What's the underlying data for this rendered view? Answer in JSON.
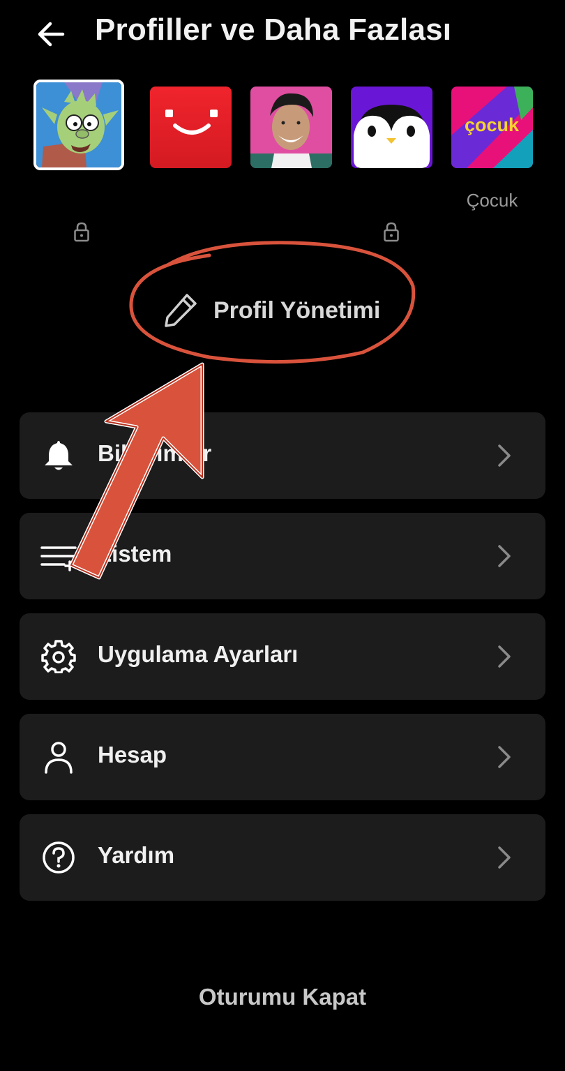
{
  "header": {
    "title": "Profiller ve Daha Fazlası",
    "back_icon": "arrow-left-icon"
  },
  "profiles": [
    {
      "name": "",
      "avatar": "elf-cartoon-avatar",
      "selected": true,
      "locked": true
    },
    {
      "name": "",
      "avatar": "red-smiley-avatar",
      "selected": false,
      "locked": false
    },
    {
      "name": "",
      "avatar": "smiling-man-photo-avatar",
      "selected": false,
      "locked": false
    },
    {
      "name": "",
      "avatar": "penguin-avatar",
      "selected": false,
      "locked": true
    },
    {
      "name": "Çocuk",
      "avatar": "cocuk-kids-avatar",
      "avatar_text": "çocuk",
      "selected": false,
      "locked": false
    }
  ],
  "manage_profiles": {
    "label": "Profil Yönetimi",
    "icon": "pencil-icon"
  },
  "menu": [
    {
      "label": "Bildirimler",
      "icon": "bell-icon"
    },
    {
      "label": "Listem",
      "icon": "list-icon"
    },
    {
      "label": "Uygulama Ayarları",
      "icon": "gear-icon"
    },
    {
      "label": "Hesap",
      "icon": "person-icon"
    },
    {
      "label": "Yardım",
      "icon": "help-icon"
    }
  ],
  "logout_label": "Oturumu Kapat",
  "colors": {
    "background": "#000000",
    "card": "#1c1c1c",
    "annotation_red": "#d9533c"
  }
}
